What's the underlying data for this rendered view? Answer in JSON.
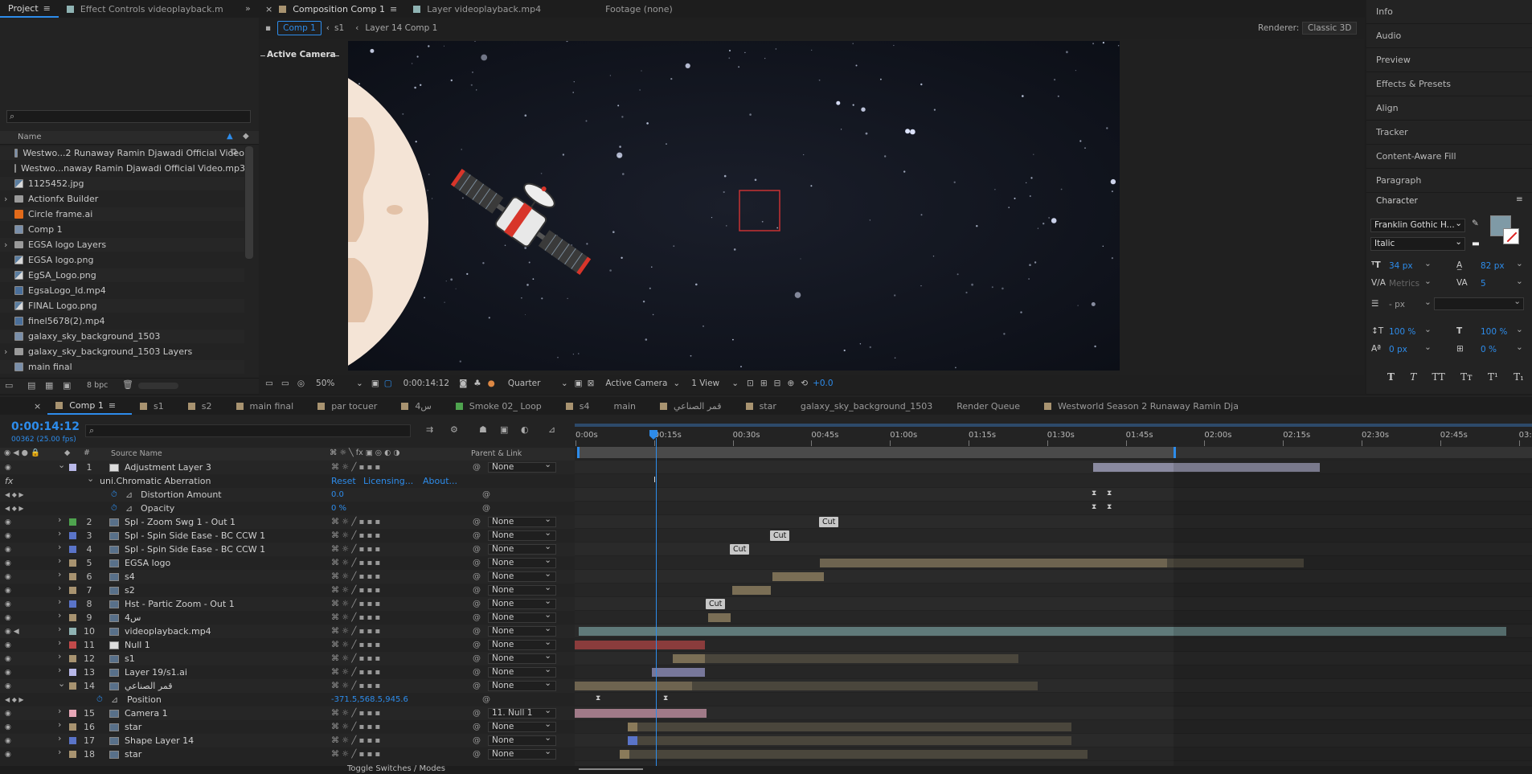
{
  "project_panel": {
    "tabs": [
      "Project",
      "Effect Controls videoplayback.m"
    ],
    "search_placeholder": "",
    "col_name": "Name",
    "items": [
      {
        "name": "Westwo...2  Runaway  Ramin Djawadi Official Video",
        "type": "comp"
      },
      {
        "name": "Westwo...naway  Ramin Djawadi Official Video.mp3",
        "type": "aud"
      },
      {
        "name": "1125452.jpg",
        "type": "img"
      },
      {
        "name": "Actionfx Builder",
        "type": "folder"
      },
      {
        "name": "Circle frame.ai",
        "type": "ai"
      },
      {
        "name": "Comp 1",
        "type": "comp"
      },
      {
        "name": "EGSA logo Layers",
        "type": "folder"
      },
      {
        "name": "EGSA logo.png",
        "type": "img"
      },
      {
        "name": "EgSA_Logo.png",
        "type": "img"
      },
      {
        "name": "EgsaLogo_Id.mp4",
        "type": "vid"
      },
      {
        "name": "FINAL Logo.png",
        "type": "img"
      },
      {
        "name": "finel5678(2).mp4",
        "type": "vid"
      },
      {
        "name": "galaxy_sky_background_1503",
        "type": "comp"
      },
      {
        "name": "galaxy_sky_background_1503 Layers",
        "type": "folder"
      },
      {
        "name": "main final",
        "type": "comp"
      }
    ],
    "bpc": "8 bpc"
  },
  "comp_panel": {
    "tabs": [
      "Composition Comp 1",
      "Layer videoplayback.mp4",
      "Footage (none)"
    ],
    "breadcrumb": [
      "Comp 1",
      "s1",
      "Layer 14 Comp 1"
    ],
    "renderer_label": "Renderer:",
    "renderer_value": "Classic 3D",
    "active_camera": "Active Camera",
    "footer": {
      "zoom": "50%",
      "timecode": "0:00:14:12",
      "resolution": "Quarter",
      "view": "Active Camera",
      "views": "1 View",
      "exposure": "+0.0"
    }
  },
  "right_panel": {
    "items": [
      "Info",
      "Audio",
      "Preview",
      "Effects & Presets",
      "Align",
      "Tracker",
      "Content-Aware Fill",
      "Paragraph"
    ],
    "character": {
      "title": "Character",
      "font": "Franklin Gothic H...",
      "style": "Italic",
      "size": "34 px",
      "leading": "82 px",
      "kerning": "Metrics",
      "tracking": "5",
      "stroke": "- px",
      "vscale": "100 %",
      "hscale": "100 %",
      "baseline": "0 px",
      "tsume": "0 %",
      "fill_color": "#7f9aa6"
    },
    "type_buttons": [
      "T",
      "T",
      "TT",
      "Tт",
      "T¹",
      "T₁"
    ]
  },
  "timeline": {
    "tabs": [
      "Comp 1",
      "s1",
      "s2",
      "main final",
      "par tocuer",
      "س4",
      "Smoke 02_ Loop",
      "s4",
      "main",
      "قمر الصناعي",
      "star",
      "galaxy_sky_background_1503",
      "Render Queue",
      "Westworld Season 2  Runaway  Ramin Dja"
    ],
    "timecode": "0:00:14:12",
    "frames": "00362 (25.00 fps)",
    "col_source": "Source Name",
    "col_parent": "Parent & Link",
    "ruler": [
      "0:00s",
      "00:15s",
      "00:30s",
      "00:45s",
      "01:00s",
      "01:15s",
      "01:30s",
      "01:45s",
      "02:00s",
      "02:15s",
      "02:30s",
      "02:45s",
      "03:00"
    ],
    "effect_name": "uni.Chromatic Aberration",
    "effect_links": [
      "Reset",
      "Licensing...",
      "About..."
    ],
    "props": [
      {
        "name": "Distortion Amount",
        "value": "0.0"
      },
      {
        "name": "Opacity",
        "value": "0 %"
      },
      {
        "name": "Position",
        "value": "-371.5,568.5,945.6"
      }
    ],
    "layers": [
      {
        "num": "1",
        "name": "Adjustment Layer 3",
        "color": "#b8b8e8",
        "parent": "None"
      },
      {
        "num": "2",
        "name": "Spl - Zoom Swg 1 - Out 1",
        "color": "#4ea34e",
        "parent": "None"
      },
      {
        "num": "3",
        "name": "Spl - Spin Side Ease - BC CCW 1",
        "color": "#5a74c8",
        "parent": "None"
      },
      {
        "num": "4",
        "name": "Spl - Spin Side Ease - BC CCW 1",
        "color": "#5a74c8",
        "parent": "None"
      },
      {
        "num": "5",
        "name": "EGSA logo",
        "color": "#a89370",
        "parent": "None"
      },
      {
        "num": "6",
        "name": "s4",
        "color": "#a89370",
        "parent": "None"
      },
      {
        "num": "7",
        "name": "s2",
        "color": "#a89370",
        "parent": "None"
      },
      {
        "num": "8",
        "name": "Hst - Partic Zoom - Out 1",
        "color": "#5a74c8",
        "parent": "None"
      },
      {
        "num": "9",
        "name": "س4",
        "color": "#a89370",
        "parent": "None"
      },
      {
        "num": "10",
        "name": "videoplayback.mp4",
        "color": "#8fb3b3",
        "parent": "None"
      },
      {
        "num": "11",
        "name": "Null 1",
        "color": "#c24a4a",
        "parent": "None"
      },
      {
        "num": "12",
        "name": "s1",
        "color": "#a89370",
        "parent": "None"
      },
      {
        "num": "13",
        "name": "Layer 19/s1.ai",
        "color": "#b8b8e8",
        "parent": "None"
      },
      {
        "num": "14",
        "name": "قمر الصناعي",
        "color": "#a89370",
        "parent": "None"
      },
      {
        "num": "15",
        "name": "Camera 1",
        "color": "#e8a8b8",
        "parent": "11. Null 1"
      },
      {
        "num": "16",
        "name": "star",
        "color": "#a89370",
        "parent": "None"
      },
      {
        "num": "17",
        "name": "Shape Layer 14",
        "color": "#5a74c8",
        "parent": "None"
      },
      {
        "num": "18",
        "name": "star",
        "color": "#a89370",
        "parent": "None"
      }
    ],
    "cut_label": "Cut",
    "footer_toggle": "Toggle Switches / Modes"
  }
}
